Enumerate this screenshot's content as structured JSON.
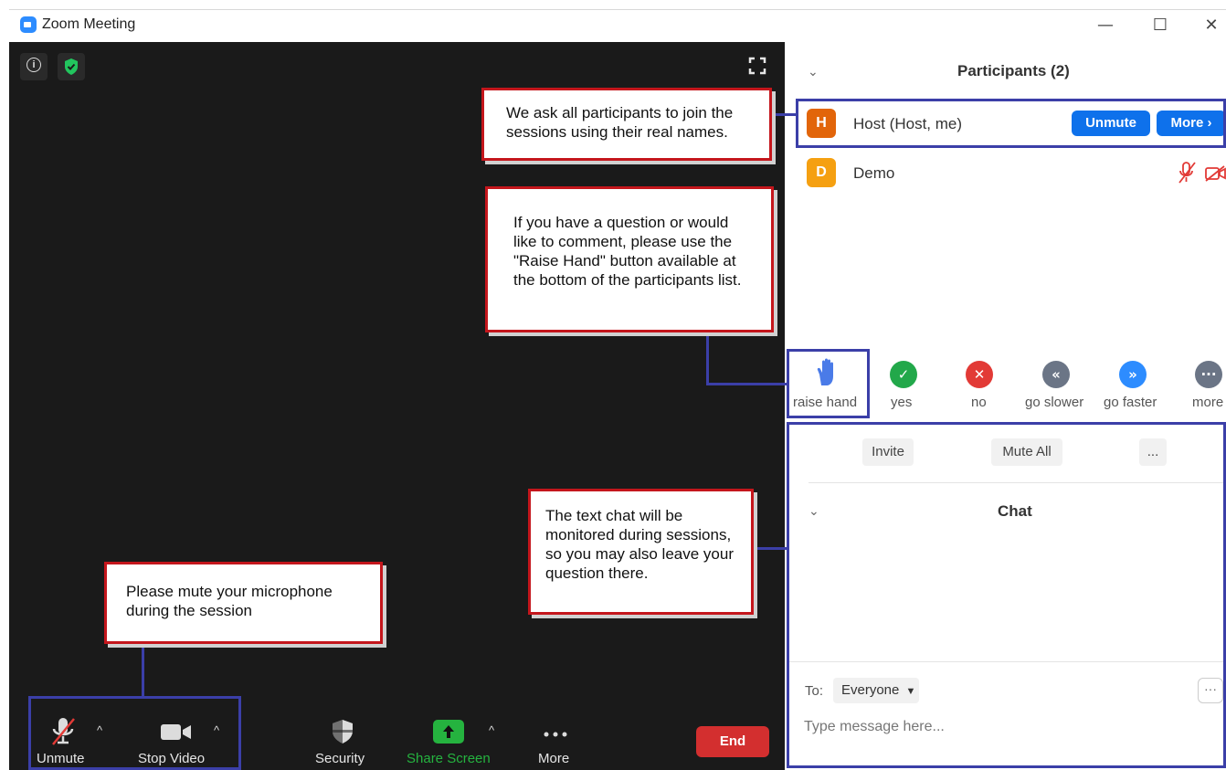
{
  "window": {
    "title": "Zoom Meeting",
    "minimize": "—",
    "maximize": "☐",
    "close": "✕"
  },
  "toolbar": {
    "unmute_label": "Unmute",
    "stop_video_label": "Stop Video",
    "security_label": "Security",
    "share_screen_label": "Share Screen",
    "more_label": "More",
    "end_label": "End",
    "caret": "^"
  },
  "participants": {
    "title": "Participants (2)",
    "list": [
      {
        "initial": "H",
        "name": "Host (Host, me)",
        "avatar_color": "#e2650a"
      },
      {
        "initial": "D",
        "name": "Demo",
        "avatar_color": "#f5a011"
      }
    ],
    "unmute_button": "Unmute",
    "more_button": "More ›"
  },
  "reactions": [
    {
      "label": "raise hand",
      "icon": "hand-icon",
      "color": "#4a7be8"
    },
    {
      "label": "yes",
      "icon": "check-icon",
      "color": "#22a84a"
    },
    {
      "label": "no",
      "icon": "x-icon",
      "color": "#e23a36"
    },
    {
      "label": "go slower",
      "icon": "rewind-icon",
      "color": "#6b7586"
    },
    {
      "label": "go faster",
      "icon": "fast-forward-icon",
      "color": "#2d8cff"
    },
    {
      "label": "more",
      "icon": "ellipsis-icon",
      "color": "#6b7586"
    }
  ],
  "actions": {
    "invite": "Invite",
    "mute_all": "Mute All",
    "more": "..."
  },
  "chat": {
    "title": "Chat",
    "to_label": "To:",
    "recipient": "Everyone",
    "placeholder": "Type message here...",
    "more": "···"
  },
  "callouts": {
    "real_names": "We ask all participants to join the sessions using their real names.",
    "raise_hand": "If you have a question or would like to comment, please use the \"Raise Hand\" button available at the bottom of the participants list.",
    "chat": "The text chat will be monitored during sessions, so you may also leave your question there.",
    "mute": "Please mute your microphone during the session"
  },
  "colors": {
    "zoom_blue": "#0e71eb",
    "end_red": "#d32f2f",
    "share_green": "#25b33f",
    "callout_border": "#c4161c",
    "highlight_border": "#3b3fa8"
  }
}
